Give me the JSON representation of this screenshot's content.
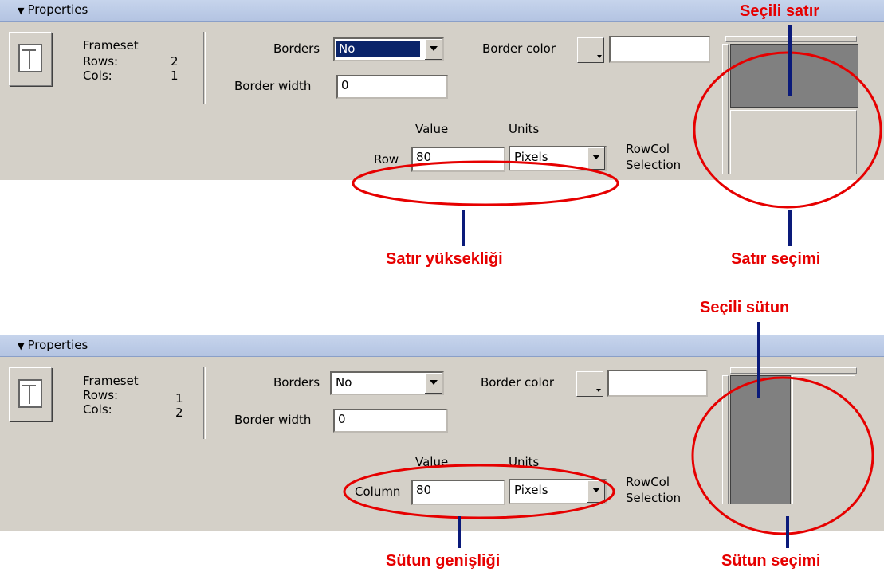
{
  "panels": [
    {
      "title": "Properties",
      "frameset_label": "Frameset",
      "rows_label": "Rows:",
      "rows_value": "2",
      "cols_label": "Cols:",
      "cols_value": "1",
      "borders_label": "Borders",
      "borders_value": "No",
      "border_color_label": "Border color",
      "border_color_value": "",
      "border_width_label": "Border width",
      "border_width_value": "0",
      "value_header": "Value",
      "units_header": "Units",
      "rowcol_label": "Row",
      "rowcol_value": "80",
      "units_value": "Pixels",
      "selection_label_1": "RowCol",
      "selection_label_2": "Selection"
    },
    {
      "title": "Properties",
      "frameset_label": "Frameset",
      "rows_label": "Rows:",
      "rows_value": "1",
      "cols_label": "Cols:",
      "cols_value": "2",
      "borders_label": "Borders",
      "borders_value": "No",
      "border_color_label": "Border color",
      "border_color_value": "",
      "border_width_label": "Border width",
      "border_width_value": "0",
      "value_header": "Value",
      "units_header": "Units",
      "rowcol_label": "Column",
      "rowcol_value": "80",
      "units_value": "Pixels",
      "selection_label_1": "RowCol",
      "selection_label_2": "Selection"
    }
  ],
  "annotations": {
    "selected_row": "Seçili satır",
    "row_height": "Satır yüksekliği",
    "row_selection": "Satır seçimi",
    "selected_column": "Seçili sütun",
    "column_width": "Sütun genişliği",
    "column_selection": "Sütun seçimi"
  },
  "colors": {
    "annotation_red": "#e60000",
    "stem_navy": "#0a1a7a",
    "panel_gray": "#d4d0c8",
    "selected_frame": "#808080"
  }
}
